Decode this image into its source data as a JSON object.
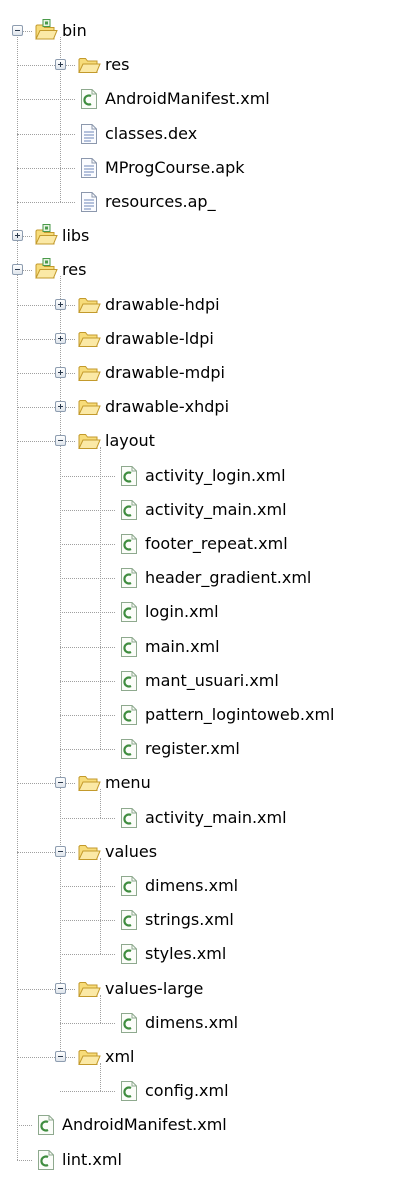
{
  "tree": [
    {
      "depth": 0,
      "label": "bin",
      "icon": "package-folder-icon",
      "toggle": "minus"
    },
    {
      "depth": 1,
      "label": "res",
      "icon": "folder-icon",
      "toggle": "plus"
    },
    {
      "depth": 1,
      "label": "AndroidManifest.xml",
      "icon": "xml-file-icon",
      "toggle": null
    },
    {
      "depth": 1,
      "label": "classes.dex",
      "icon": "file-icon",
      "toggle": null
    },
    {
      "depth": 1,
      "label": "MProgCourse.apk",
      "icon": "file-icon",
      "toggle": null
    },
    {
      "depth": 1,
      "label": "resources.ap_",
      "icon": "file-icon",
      "toggle": null
    },
    {
      "depth": 0,
      "label": "libs",
      "icon": "package-folder-icon",
      "toggle": "plus"
    },
    {
      "depth": 0,
      "label": "res",
      "icon": "package-folder-icon",
      "toggle": "minus"
    },
    {
      "depth": 1,
      "label": "drawable-hdpi",
      "icon": "folder-icon",
      "toggle": "plus"
    },
    {
      "depth": 1,
      "label": "drawable-ldpi",
      "icon": "folder-icon",
      "toggle": "plus"
    },
    {
      "depth": 1,
      "label": "drawable-mdpi",
      "icon": "folder-icon",
      "toggle": "plus"
    },
    {
      "depth": 1,
      "label": "drawable-xhdpi",
      "icon": "folder-icon",
      "toggle": "plus"
    },
    {
      "depth": 1,
      "label": "layout",
      "icon": "folder-icon",
      "toggle": "minus"
    },
    {
      "depth": 2,
      "label": "activity_login.xml",
      "icon": "xml-file-icon",
      "toggle": null
    },
    {
      "depth": 2,
      "label": "activity_main.xml",
      "icon": "xml-file-icon",
      "toggle": null
    },
    {
      "depth": 2,
      "label": "footer_repeat.xml",
      "icon": "xml-file-icon",
      "toggle": null
    },
    {
      "depth": 2,
      "label": "header_gradient.xml",
      "icon": "xml-file-icon",
      "toggle": null
    },
    {
      "depth": 2,
      "label": "login.xml",
      "icon": "xml-file-icon",
      "toggle": null
    },
    {
      "depth": 2,
      "label": "main.xml",
      "icon": "xml-file-icon",
      "toggle": null
    },
    {
      "depth": 2,
      "label": "mant_usuari.xml",
      "icon": "xml-file-icon",
      "toggle": null
    },
    {
      "depth": 2,
      "label": "pattern_logintoweb.xml",
      "icon": "xml-file-icon",
      "toggle": null
    },
    {
      "depth": 2,
      "label": "register.xml",
      "icon": "xml-file-icon",
      "toggle": null
    },
    {
      "depth": 1,
      "label": "menu",
      "icon": "folder-icon",
      "toggle": "minus"
    },
    {
      "depth": 2,
      "label": "activity_main.xml",
      "icon": "xml-file-icon",
      "toggle": null
    },
    {
      "depth": 1,
      "label": "values",
      "icon": "folder-icon",
      "toggle": "minus"
    },
    {
      "depth": 2,
      "label": "dimens.xml",
      "icon": "xml-file-icon",
      "toggle": null
    },
    {
      "depth": 2,
      "label": "strings.xml",
      "icon": "xml-file-icon",
      "toggle": null
    },
    {
      "depth": 2,
      "label": "styles.xml",
      "icon": "xml-file-icon",
      "toggle": null
    },
    {
      "depth": 1,
      "label": "values-large",
      "icon": "folder-icon",
      "toggle": "minus"
    },
    {
      "depth": 2,
      "label": "dimens.xml",
      "icon": "xml-file-icon",
      "toggle": null
    },
    {
      "depth": 1,
      "label": "xml",
      "icon": "folder-icon",
      "toggle": "minus"
    },
    {
      "depth": 2,
      "label": "config.xml",
      "icon": "xml-file-icon",
      "toggle": null
    },
    {
      "depth": 0,
      "label": "AndroidManifest.xml",
      "icon": "xml-file-icon",
      "toggle": null
    },
    {
      "depth": 0,
      "label": "lint.xml",
      "icon": "xml-file-icon",
      "toggle": null
    }
  ],
  "colors": {
    "folder_fill": "#f7dc7a",
    "folder_edge": "#c39a2c",
    "package_badge": "#4a9a4a",
    "xml_badge": "#3f8d3f",
    "file_line": "#6d86b8"
  }
}
